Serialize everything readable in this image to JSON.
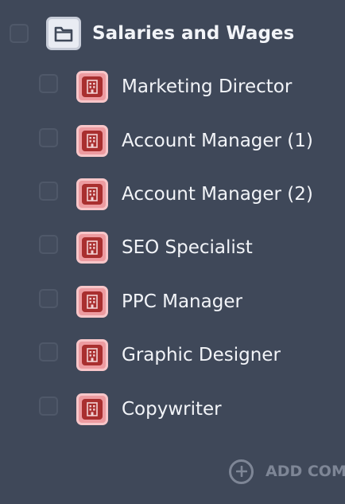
{
  "group": {
    "label": "Salaries and Wages",
    "icon": "folder-icon"
  },
  "items": [
    {
      "label": "Marketing Director",
      "icon": "building-icon"
    },
    {
      "label": "Account Manager (1)",
      "icon": "building-icon"
    },
    {
      "label": "Account Manager (2)",
      "icon": "building-icon"
    },
    {
      "label": "SEO Specialist",
      "icon": "building-icon"
    },
    {
      "label": "PPC Manager",
      "icon": "building-icon"
    },
    {
      "label": "Graphic Designer",
      "icon": "building-icon"
    },
    {
      "label": "Copywriter",
      "icon": "building-icon"
    }
  ],
  "add_button": {
    "label": "ADD COMP",
    "icon": "plus-circle-icon"
  },
  "colors": {
    "background": "#3f4859",
    "text": "#f2f4f8",
    "building_icon_bg": "#ed9ba0",
    "building_icon_fg": "#a92f2f",
    "folder_icon_bg": "#e9ecf3",
    "add_button": "#7e8696"
  }
}
